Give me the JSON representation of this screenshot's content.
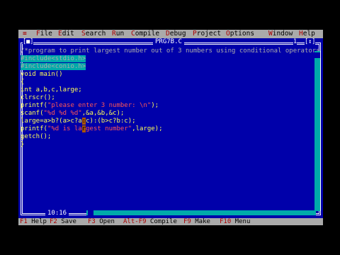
{
  "menu": {
    "system": "≡",
    "items": [
      {
        "hot": "F",
        "rest": "ile"
      },
      {
        "hot": "E",
        "rest": "dit"
      },
      {
        "hot": "S",
        "rest": "earch"
      },
      {
        "hot": "R",
        "rest": "un"
      },
      {
        "hot": "C",
        "rest": "ompile"
      },
      {
        "hot": "D",
        "rest": "ebug"
      },
      {
        "hot": "P",
        "rest": "roject"
      },
      {
        "hot": "O",
        "rest": "ptions"
      },
      {
        "hot": "W",
        "rest": "indow"
      },
      {
        "hot": "H",
        "rest": "elp"
      }
    ]
  },
  "editor": {
    "close_box": "[■]",
    "title": "PRG7B.C",
    "window_number": "1",
    "zoom_box": "[↕]",
    "cursor_position": "10:16"
  },
  "code": {
    "comment": "/*program to print largest number out of 3 numbers using conditional operators",
    "include1": "#include<stdio.h>",
    "include2": "#include<conio.h>",
    "line_main": "void main()",
    "line_open": "{",
    "line_decl": "int a,b,c,large;",
    "line_clr": "clrscr();",
    "printf1_a": "printf(",
    "printf1_s": "\"please enter 3 number: \\n\"",
    "printf1_b": ");",
    "scanf_a": "scanf(",
    "scanf_s": "\"%d %d %d\"",
    "scanf_b": ",&a,&b,&c);",
    "large_a": "large=a>b?(a>c?a",
    "large_cur": ":",
    "large_b": "c):(b>c?b:c);",
    "printf2_a": "printf(",
    "printf2_s1": "\"%d is la",
    "printf2_cur": "r",
    "printf2_s2": "gest number\"",
    "printf2_b": ",large);",
    "line_getch": "getch();",
    "line_close": "}"
  },
  "status": [
    {
      "key": "F1",
      "label": " Help"
    },
    {
      "key": "F2",
      "label": " Save"
    },
    {
      "key": "F3",
      "label": " Open"
    },
    {
      "key": "Alt-F9",
      "label": " Compile"
    },
    {
      "key": "F9",
      "label": " Make"
    },
    {
      "key": "F10",
      "label": " Menu"
    }
  ],
  "colors": {
    "background": "#0000AA",
    "text": "#FFFF55",
    "menu": "#AAAAAA",
    "hotkey": "#AA0000"
  }
}
